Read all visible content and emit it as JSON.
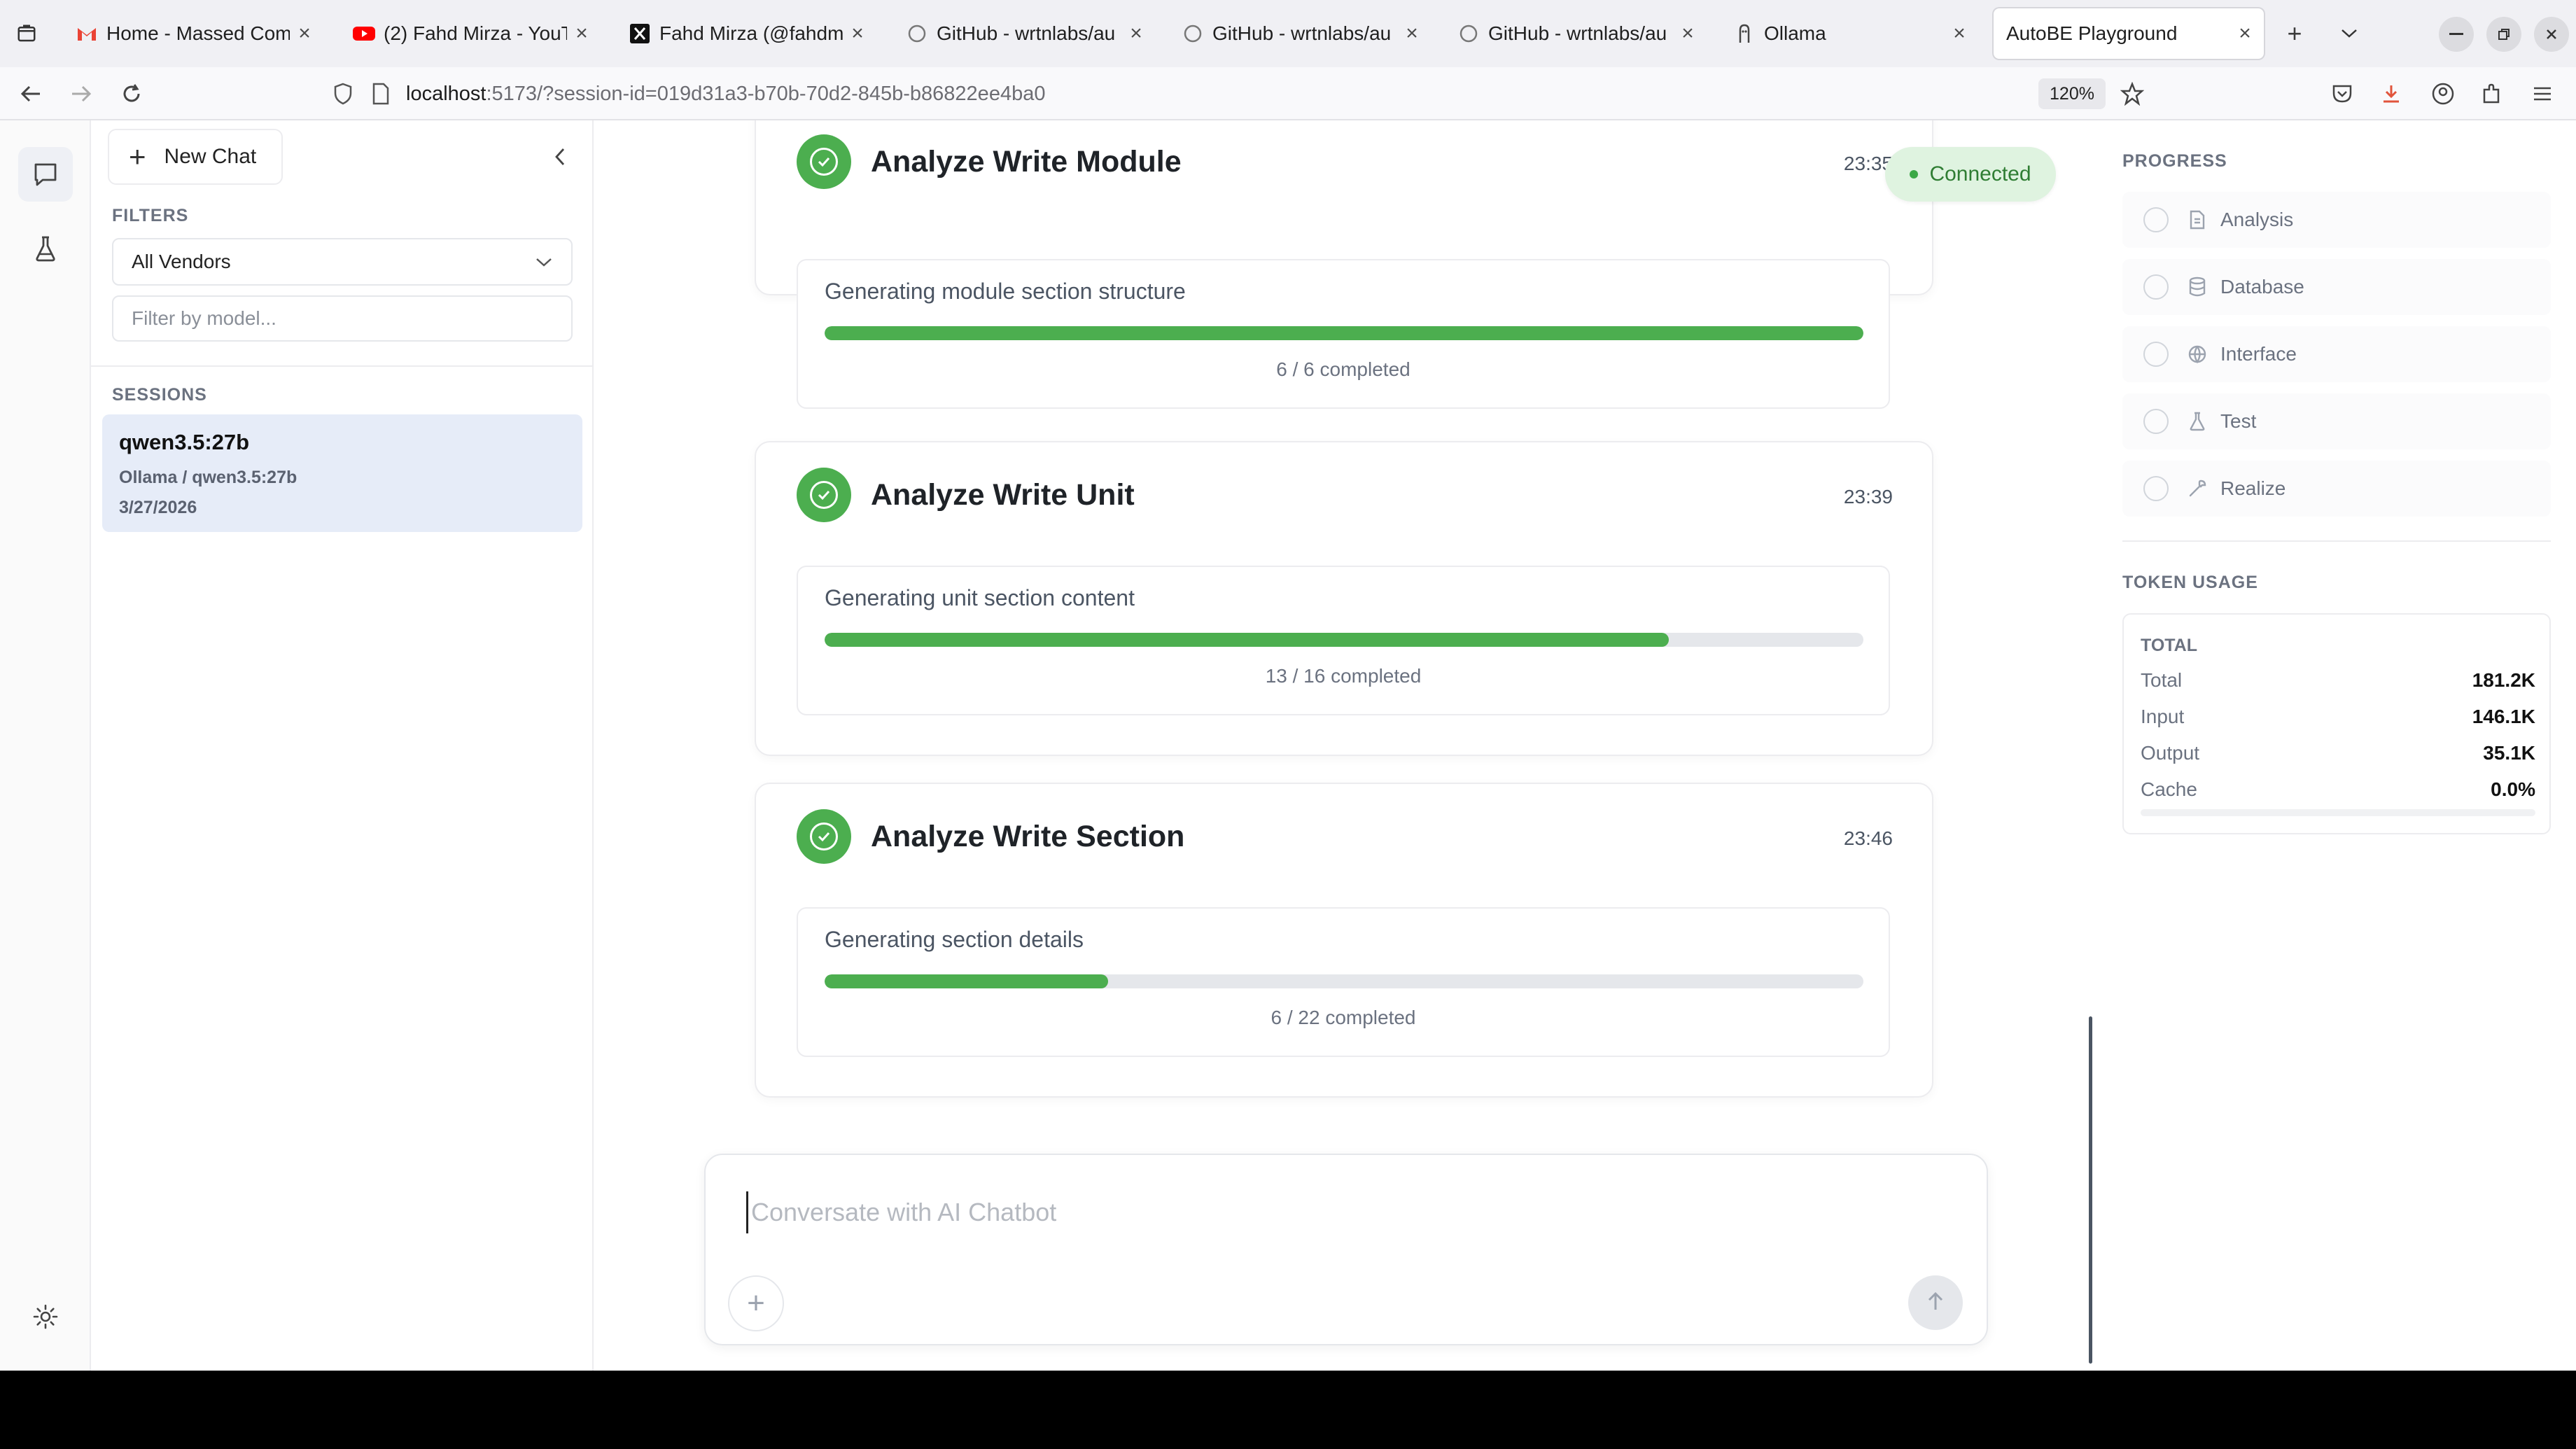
{
  "browser": {
    "tabs": [
      {
        "title": "Home - Massed Comp",
        "icon": "gmail-icon"
      },
      {
        "title": "(2) Fahd Mirza - YouT",
        "icon": "youtube-icon"
      },
      {
        "title": "Fahd Mirza (@fahdmi",
        "icon": "x-icon"
      },
      {
        "title": "GitHub - wrtnlabs/au",
        "icon": "github-icon"
      },
      {
        "title": "GitHub - wrtnlabs/au",
        "icon": "github-icon"
      },
      {
        "title": "GitHub - wrtnlabs/au",
        "icon": "github-icon"
      },
      {
        "title": "Ollama",
        "icon": "ollama-icon"
      },
      {
        "title": "AutoBE Playground",
        "icon": "none",
        "active": true
      }
    ],
    "url_host": "localhost",
    "url_rest": ":5173/?session-id=019d31a3-b70b-70d2-845b-b86822ee4ba0",
    "zoom": "120%"
  },
  "sidebar": {
    "new_chat": "New Chat",
    "filters_label": "FILTERS",
    "vendor_selected": "All Vendors",
    "model_placeholder": "Filter by model...",
    "sessions_label": "SESSIONS",
    "sessions": [
      {
        "title": "qwen3.5:27b",
        "subtitle": "Ollama / qwen3.5:27b",
        "date": "3/27/2026"
      }
    ]
  },
  "main": {
    "connection_status": "Connected",
    "events": [
      {
        "title": "Analyze Write Module",
        "time": "23:35",
        "label": "Generating module section structure",
        "done": 6,
        "total": 6,
        "count_text": "6 / 6 completed"
      },
      {
        "title": "Analyze Write Unit",
        "time": "23:39",
        "label": "Generating unit section content",
        "done": 13,
        "total": 16,
        "count_text": "13 / 16 completed"
      },
      {
        "title": "Analyze Write Section",
        "time": "23:46",
        "label": "Generating section details",
        "done": 6,
        "total": 22,
        "count_text": "6 / 22 completed"
      }
    ],
    "composer_placeholder": "Conversate with AI Chatbot"
  },
  "progress": {
    "label": "PROGRESS",
    "steps": [
      {
        "label": "Analysis",
        "icon": "document-icon"
      },
      {
        "label": "Database",
        "icon": "database-icon"
      },
      {
        "label": "Interface",
        "icon": "globe-icon"
      },
      {
        "label": "Test",
        "icon": "flask-icon"
      },
      {
        "label": "Realize",
        "icon": "wrench-icon"
      }
    ]
  },
  "token_usage": {
    "label": "TOKEN USAGE",
    "total_label": "TOTAL",
    "rows": [
      {
        "key": "Total",
        "value": "181.2K"
      },
      {
        "key": "Input",
        "value": "146.1K"
      },
      {
        "key": "Output",
        "value": "35.1K"
      },
      {
        "key": "Cache",
        "value": "0.0%"
      }
    ],
    "cache_fraction": 0.0
  },
  "colors": {
    "accent_green": "#4cae4f",
    "connected_bg": "#dff3e0",
    "session_bg": "#e6ecf8"
  }
}
